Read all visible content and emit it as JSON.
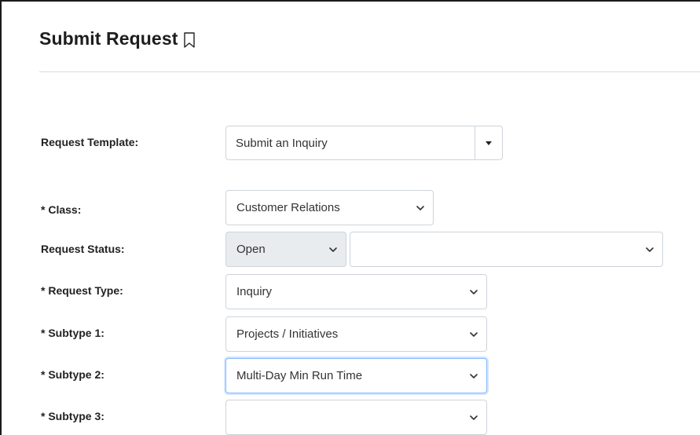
{
  "header": {
    "title": "Submit Request"
  },
  "form": {
    "request_template": {
      "label": "Request Template:",
      "value": "Submit an Inquiry"
    },
    "class": {
      "label": "* Class:",
      "value": "Customer Relations"
    },
    "request_status": {
      "label": "Request Status:",
      "value": "Open",
      "secondary_value": ""
    },
    "request_type": {
      "label": "* Request Type:",
      "value": "Inquiry"
    },
    "subtype1": {
      "label": "* Subtype 1:",
      "value": "Projects / Initiatives"
    },
    "subtype2": {
      "label": "* Subtype 2:",
      "value": "Multi-Day Min Run Time"
    },
    "subtype3": {
      "label": "* Subtype 3:",
      "value": ""
    }
  },
  "icons": {
    "title_icon": "bookmark-icon",
    "select_arrow": "chevron-down-icon",
    "combo_arrow": "caret-down-icon"
  },
  "colors": {
    "border": "#ced4da",
    "disabled_bg": "#e9ecef",
    "focus_border": "#86b7fe"
  }
}
